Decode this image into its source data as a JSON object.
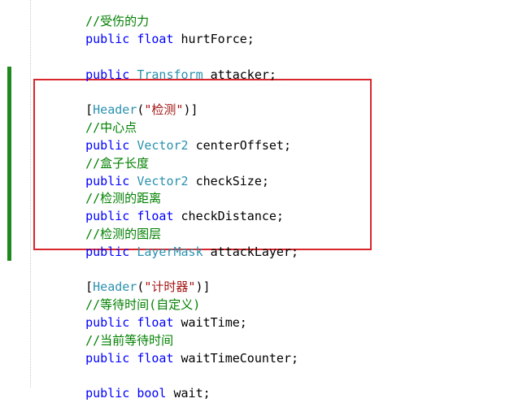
{
  "colors": {
    "keyword": "#0000ff",
    "type": "#2b91af",
    "comment": "#008000",
    "string": "#a31515",
    "change_bar": "#1e8a1e",
    "highlight_border": "#d9262c"
  },
  "code": {
    "line_comment_hurt": "//受伤的力",
    "line_hurtForce": {
      "kw": "public",
      "type": "float",
      "name": " hurtForce;"
    },
    "line_attacker": {
      "kw": "public",
      "type": "Transform",
      "name": " attacker;"
    },
    "header_check": {
      "open": "[",
      "attr": "Header",
      "paren_open": "(",
      "str": "\"检测\"",
      "close": ")]"
    },
    "comment_center": "//中心点",
    "line_centerOffset": {
      "kw": "public",
      "type": "Vector2",
      "name": " centerOffset;"
    },
    "comment_box": "//盒子长度",
    "line_checkSize": {
      "kw": "public",
      "type": "Vector2",
      "name": " checkSize;"
    },
    "comment_distance": "//检测的距离",
    "line_checkDistance": {
      "kw": "public",
      "type": "float",
      "name": " checkDistance;"
    },
    "comment_layer": "//检测的图层",
    "line_attackLayer": {
      "kw": "public",
      "type": "LayerMask",
      "name": " attackLayer;"
    },
    "header_timer": {
      "open": "[",
      "attr": "Header",
      "paren_open": "(",
      "str": "\"计时器\"",
      "close": ")]"
    },
    "comment_wait": "//等待时间(自定义)",
    "line_waitTime": {
      "kw": "public",
      "type": "float",
      "name": " waitTime;"
    },
    "comment_current_wait": "//当前等待时间",
    "line_waitTimeCounter": {
      "kw": "public",
      "type": "float",
      "name": " waitTimeCounter;"
    },
    "line_wait": {
      "kw": "public",
      "type": "bool",
      "name": " wait;"
    }
  }
}
